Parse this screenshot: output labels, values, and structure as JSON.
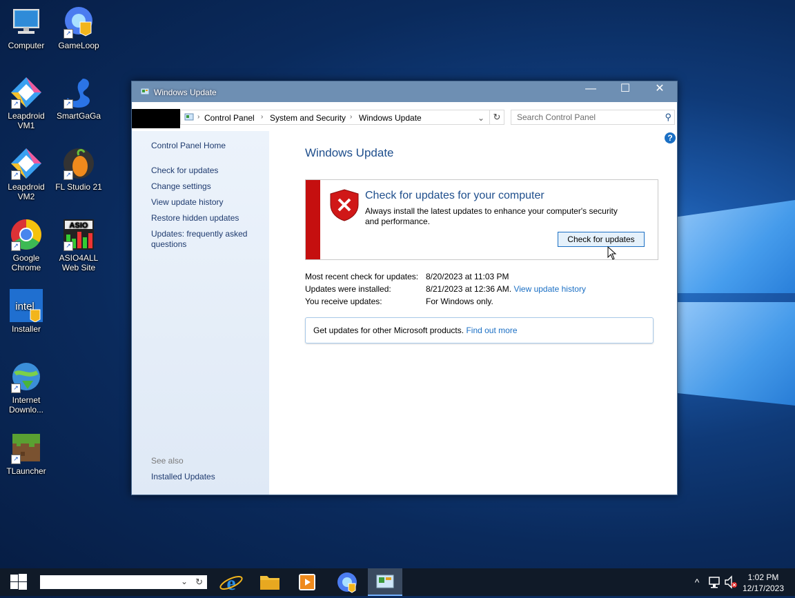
{
  "desktop": {
    "icons": [
      {
        "label": "Computer"
      },
      {
        "label": "GameLoop"
      },
      {
        "label": "Leapdroid VM1"
      },
      {
        "label": "SmartGaGa"
      },
      {
        "label": "Leapdroid VM2"
      },
      {
        "label": "FL Studio 21"
      },
      {
        "label": "Google Chrome"
      },
      {
        "label": "ASIO4ALL Web Site"
      },
      {
        "label": "Installer"
      },
      {
        "label": "Internet Downlo..."
      },
      {
        "label": "TLauncher"
      }
    ]
  },
  "window": {
    "title": "Windows Update",
    "controls": {
      "minimize": "—",
      "maximize": "☐",
      "close": "✕"
    },
    "address": {
      "crumbs": [
        "Control Panel",
        "System and Security",
        "Windows Update"
      ],
      "search_placeholder": "Search Control Panel"
    },
    "sidebar": {
      "home": "Control Panel Home",
      "links": [
        "Check for updates",
        "Change settings",
        "View update history",
        "Restore hidden updates",
        "Updates: frequently asked questions"
      ],
      "see_also_label": "See also",
      "see_also": [
        "Installed Updates"
      ]
    },
    "main": {
      "title": "Windows Update",
      "alert": {
        "heading": "Check for updates for your computer",
        "description": "Always install the latest updates to enhance your computer's security and performance.",
        "button": "Check for updates"
      },
      "status": [
        {
          "key": "Most recent check for updates:",
          "value": "8/20/2023 at 11:03 PM",
          "link": ""
        },
        {
          "key": "Updates were installed:",
          "value": "8/21/2023 at 12:36 AM.",
          "link": "View update history"
        },
        {
          "key": "You receive updates:",
          "value": "For Windows only.",
          "link": ""
        }
      ],
      "other": {
        "text": "Get updates for other Microsoft products.",
        "link": "Find out more"
      }
    }
  },
  "taskbar": {
    "clock_time": "1:02 PM",
    "clock_date": "12/17/2023"
  }
}
